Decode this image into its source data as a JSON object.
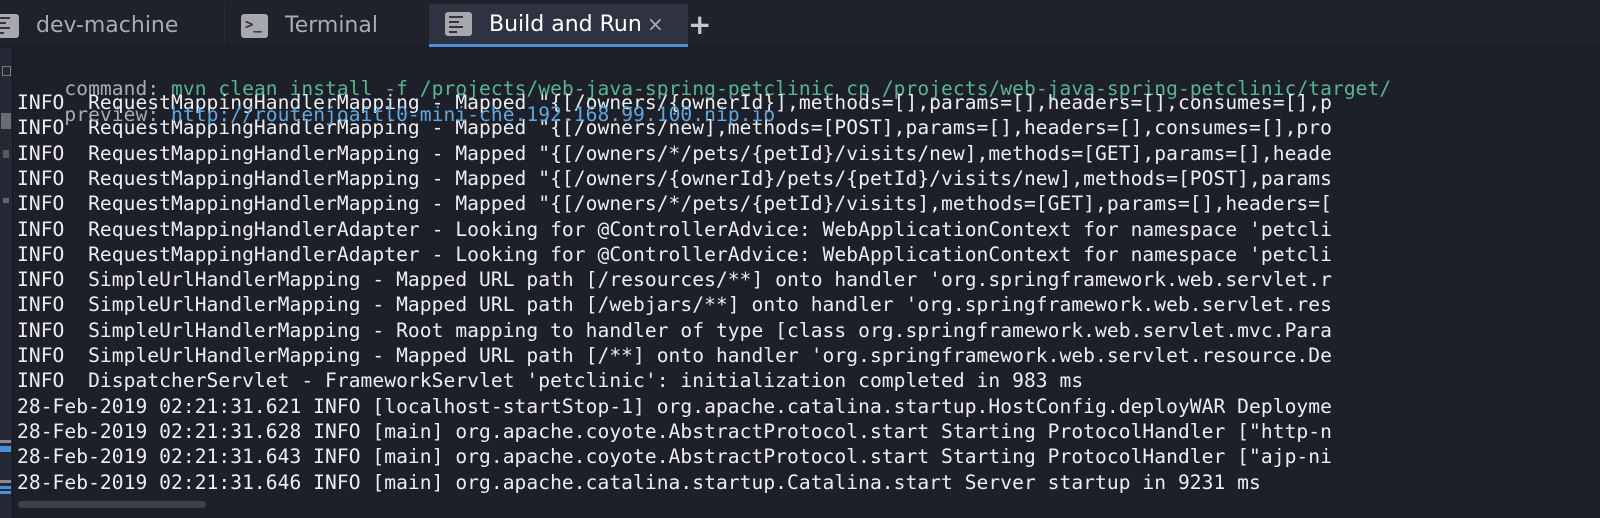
{
  "tabs": [
    {
      "label": "dev-machine",
      "icon": "list-icon",
      "active": false
    },
    {
      "label": "Terminal",
      "icon": "terminal-icon",
      "active": false
    },
    {
      "label": "Build and Run",
      "icon": "list-icon",
      "active": true,
      "close_glyph": "×"
    }
  ],
  "add_tab_glyph": "+",
  "colors": {
    "accent": "#4a90d9",
    "command": "#59b58f",
    "url": "#5fa7e0",
    "background": "#1e2029"
  },
  "header": {
    "command_label": "command:",
    "command_value": "mvn clean install -f /projects/web-java-spring-petclinic cp /projects/web-java-spring-petclinic/target/",
    "preview_label": "preview:",
    "preview_url": "http://routenjoaitl0-mini-che.192.168.99.100.nip.io"
  },
  "log_lines": [
    "INFO  RequestMappingHandlerMapping - Mapped \"{[/owners/{ownerId}],methods=[],params=[],headers=[],consumes=[],p",
    "INFO  RequestMappingHandlerMapping - Mapped \"{[/owners/new],methods=[POST],params=[],headers=[],consumes=[],pro",
    "INFO  RequestMappingHandlerMapping - Mapped \"{[/owners/*/pets/{petId}/visits/new],methods=[GET],params=[],heade",
    "INFO  RequestMappingHandlerMapping - Mapped \"{[/owners/{ownerId}/pets/{petId}/visits/new],methods=[POST],params",
    "INFO  RequestMappingHandlerMapping - Mapped \"{[/owners/*/pets/{petId}/visits],methods=[GET],params=[],headers=[",
    "INFO  RequestMappingHandlerAdapter - Looking for @ControllerAdvice: WebApplicationContext for namespace 'petcli",
    "INFO  RequestMappingHandlerAdapter - Looking for @ControllerAdvice: WebApplicationContext for namespace 'petcli",
    "INFO  SimpleUrlHandlerMapping - Mapped URL path [/resources/**] onto handler 'org.springframework.web.servlet.r",
    "INFO  SimpleUrlHandlerMapping - Mapped URL path [/webjars/**] onto handler 'org.springframework.web.servlet.res",
    "INFO  SimpleUrlHandlerMapping - Root mapping to handler of type [class org.springframework.web.servlet.mvc.Para",
    "INFO  SimpleUrlHandlerMapping - Mapped URL path [/**] onto handler 'org.springframework.web.servlet.resource.De",
    "INFO  DispatcherServlet - FrameworkServlet 'petclinic': initialization completed in 983 ms",
    "28-Feb-2019 02:21:31.621 INFO [localhost-startStop-1] org.apache.catalina.startup.HostConfig.deployWAR Deployme",
    "28-Feb-2019 02:21:31.628 INFO [main] org.apache.coyote.AbstractProtocol.start Starting ProtocolHandler [\"http-n",
    "28-Feb-2019 02:21:31.643 INFO [main] org.apache.coyote.AbstractProtocol.start Starting ProtocolHandler [\"ajp-ni",
    "28-Feb-2019 02:21:31.646 INFO [main] org.apache.catalina.startup.Catalina.start Server startup in 9231 ms"
  ]
}
